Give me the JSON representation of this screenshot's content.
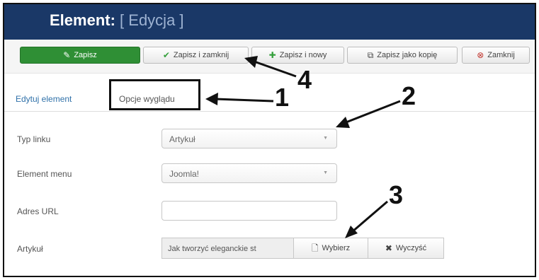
{
  "header": {
    "title": "Element:",
    "subtitle": "[ Edycja ]"
  },
  "toolbar": {
    "save": {
      "label": "Zapisz",
      "icon": "edit-icon"
    },
    "save_close": {
      "label": "Zapisz i zamknij",
      "icon": "check-icon"
    },
    "save_new": {
      "label": "Zapisz i nowy",
      "icon": "plus-icon"
    },
    "save_copy": {
      "label": "Zapisz jako kopię",
      "icon": "copy-icon"
    },
    "close": {
      "label": "Zamknij",
      "icon": "close-circle-icon"
    }
  },
  "tabs": [
    {
      "label": "Edytuj element"
    },
    {
      "label": "Opcje wyglądu"
    }
  ],
  "form": {
    "link_type": {
      "label": "Typ linku",
      "value": "Artykuł"
    },
    "menu_item": {
      "label": "Element menu",
      "value": "Joomla!"
    },
    "url": {
      "label": "Adres URL",
      "value": ""
    },
    "article": {
      "label": "Artykuł",
      "value": "Jak tworzyć eleganckie st",
      "select_label": "Wybierz",
      "clear_label": "Wyczyść"
    }
  },
  "callouts": {
    "one": "1",
    "two": "2",
    "three": "3",
    "four": "4"
  },
  "colors": {
    "header_bg": "#1a3867",
    "save_bg": "#2f8f35",
    "link": "#3071a9",
    "close_icon": "#c0322b",
    "check_icon": "#35a03c"
  }
}
